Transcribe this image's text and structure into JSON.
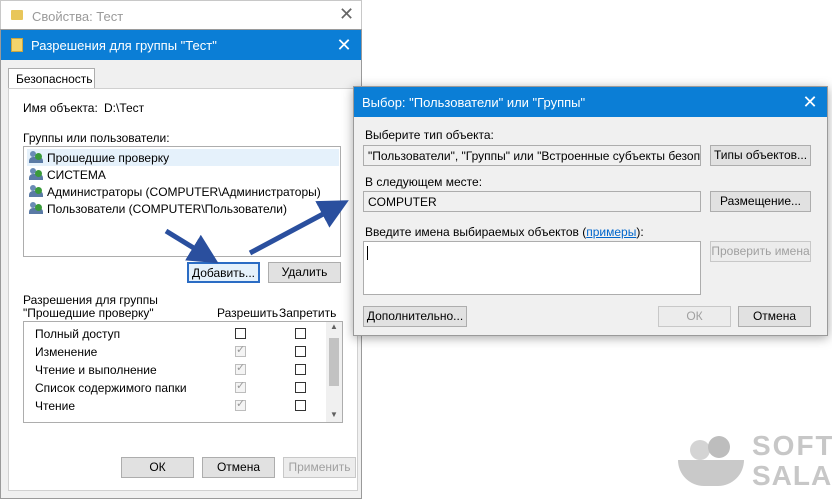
{
  "bg_window": {
    "title": "Свойства: Тест"
  },
  "perm_dialog": {
    "title": "Разрешения для группы \"Тест\"",
    "tab": "Безопасность",
    "object_label": "Имя объекта:",
    "object_value": "D:\\Тест",
    "groups_label": "Группы или пользователи:",
    "users": [
      "Прошедшие проверку",
      "СИСТЕМА",
      "Администраторы (COMPUTER\\Администраторы)",
      "Пользователи (COMPUTER\\Пользователи)"
    ],
    "add_button": "Добавить...",
    "remove_button": "Удалить",
    "perms_label_line1": "Разрешения для группы",
    "perms_label_line2": "\"Прошедшие проверку\"",
    "col_allow": "Разрешить",
    "col_deny": "Запретить",
    "permissions": [
      {
        "name": "Полный доступ",
        "allow": false,
        "deny": false
      },
      {
        "name": "Изменение",
        "allow": true,
        "deny": false
      },
      {
        "name": "Чтение и выполнение",
        "allow": true,
        "deny": false
      },
      {
        "name": "Список содержимого папки",
        "allow": true,
        "deny": false
      },
      {
        "name": "Чтение",
        "allow": true,
        "deny": false
      }
    ],
    "ok_button": "ОК",
    "cancel_button": "Отмена",
    "apply_button": "Применить"
  },
  "select_dialog": {
    "title": "Выбор: \"Пользователи\" или \"Группы\"",
    "type_label": "Выберите тип объекта:",
    "type_value": "\"Пользователи\", \"Группы\" или \"Встроенные субъекты безопасн",
    "types_button": "Типы объектов...",
    "location_label": "В следующем месте:",
    "location_value": "COMPUTER",
    "location_button": "Размещение...",
    "names_label": "Введите имена выбираемых объектов (",
    "names_link": "примеры",
    "names_label_end": "):",
    "names_value": "",
    "check_button": "Проверить имена",
    "advanced_button": "Дополнительно...",
    "ok_button": "ОК",
    "cancel_button": "Отмена"
  },
  "watermark": {
    "line1": "SOFT",
    "line2": "SALAD"
  },
  "colors": {
    "accent": "#0b7ed6",
    "arrow": "#2a4f9e"
  }
}
